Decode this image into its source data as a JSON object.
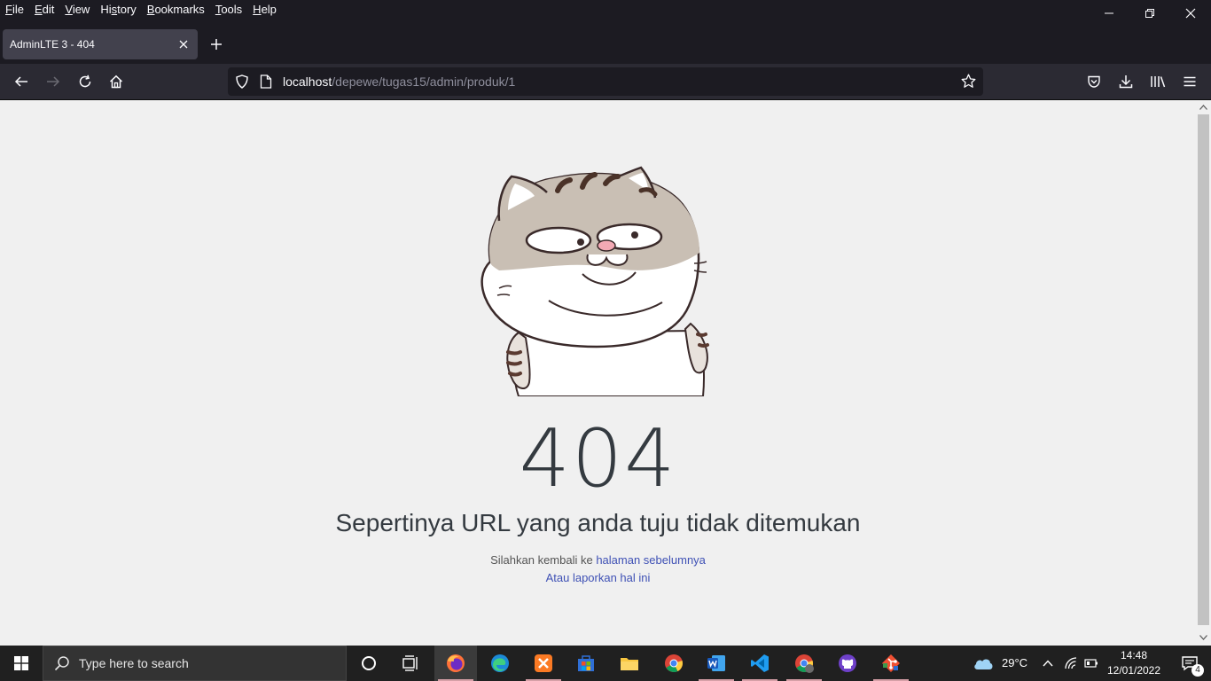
{
  "menubar": {
    "items": [
      {
        "pre": "",
        "acc": "F",
        "post": "ile"
      },
      {
        "pre": "",
        "acc": "E",
        "post": "dit"
      },
      {
        "pre": "",
        "acc": "V",
        "post": "iew"
      },
      {
        "pre": "Hi",
        "acc": "s",
        "post": "tory"
      },
      {
        "pre": "",
        "acc": "B",
        "post": "ookmarks"
      },
      {
        "pre": "",
        "acc": "T",
        "post": "ools"
      },
      {
        "pre": "",
        "acc": "H",
        "post": "elp"
      }
    ]
  },
  "tab": {
    "title": "AdminLTE 3 - 404"
  },
  "urlbar": {
    "host": "localhost",
    "path": "/depewe/tugas15/admin/produk/1"
  },
  "page": {
    "code": "404",
    "title": "Sepertinya URL yang anda tuju tidak ditemukan",
    "message_prefix": "Silahkan kembali ke ",
    "message_link": "halaman sebelumnya",
    "report_link": "Atau laporkan hal ini"
  },
  "taskbar": {
    "search_placeholder": "Type here to search",
    "weather": "29°C",
    "time": "14:48",
    "date": "12/01/2022",
    "notifications": "4"
  },
  "colors": {
    "accent_link": "#3f51b5",
    "heading": "#343a40",
    "page_bg": "#f0f0f0",
    "browser_chrome": "#1c1b22"
  }
}
